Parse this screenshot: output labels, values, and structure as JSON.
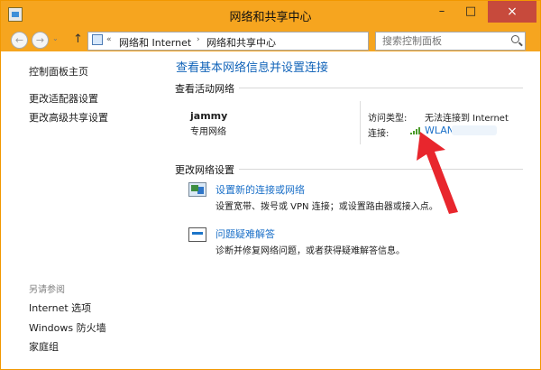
{
  "window": {
    "title": "网络和共享中心",
    "minimize_label": "–",
    "maximize_label": "□",
    "close_label": "×"
  },
  "address_bar": {
    "back_label": "←",
    "forward_label": "→",
    "up_label": "↑",
    "breadcrumb_separator_start": "«",
    "breadcrumbs": [
      "网络和 Internet",
      "网络和共享中心"
    ],
    "breadcrumb_separator": "›",
    "dropdown_label": "⌄",
    "refresh_label": "↻",
    "search_placeholder": "搜索控制面板"
  },
  "sidebar": {
    "links": [
      "控制面板主页",
      "更改适配器设置",
      "更改高级共享设置"
    ],
    "see_also_title": "另请参阅",
    "see_also_links": [
      "Internet 选项",
      "Windows 防火墙",
      "家庭组"
    ]
  },
  "main": {
    "title": "查看基本网络信息并设置连接",
    "active_networks_label": "查看活动网络",
    "network": {
      "name": "jammy",
      "type": "专用网络",
      "access_type_label": "访问类型:",
      "access_type_value": "无法连接到 Internet",
      "connection_label": "连接:",
      "connection_value": "WLAN"
    },
    "change_settings_label": "更改网络设置",
    "actions": [
      {
        "link": "设置新的连接或网络",
        "description": "设置宽带、拨号或 VPN 连接；或设置路由器或接入点。",
        "icon": "network-setup-icon"
      },
      {
        "link": "问题疑难解答",
        "description": "诊断并修复网络问题，或者获得疑难解答信息。",
        "icon": "troubleshoot-icon"
      }
    ]
  },
  "colors": {
    "title_bar": "#f6a51f",
    "link": "#1b70c8",
    "close_button": "#c74a3c",
    "annotation_arrow": "#e8262d"
  }
}
